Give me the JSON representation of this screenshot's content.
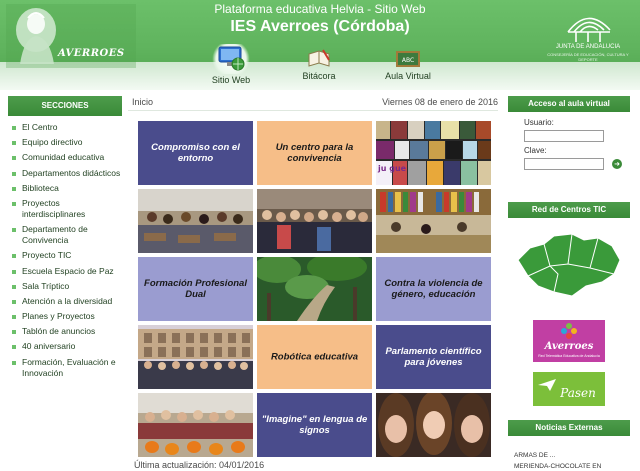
{
  "header": {
    "logo_text": "AVERROES",
    "platform": "Plataforma educativa Helvia - Sitio Web",
    "school": "IES Averroes (Córdoba)",
    "junta_name": "JUNTA DE ANDALUCIA",
    "junta_sub": "CONSEJERÍA DE EDUCACIÓN, CULTURA Y DEPORTE",
    "nav": [
      {
        "label": "Sitio Web",
        "icon": "monitor-globe-icon",
        "active": true
      },
      {
        "label": "Bitácora",
        "icon": "book-pen-icon",
        "active": false
      },
      {
        "label": "Aula Virtual",
        "icon": "abc-board-icon",
        "active": false
      }
    ]
  },
  "sidebar": {
    "title": "SECCIONES",
    "items": [
      "El Centro",
      "Equipo directivo",
      "Comunidad educativa",
      "Departamentos didácticos",
      "Biblioteca",
      "Proyectos interdisciplinares",
      "Departamento de Convivencia",
      "Proyecto TIC",
      "Escuela Espacio de Paz",
      "Sala Tríptico",
      "Atención a la diversidad",
      "Planes y Proyectos",
      "Tablón de anuncios",
      "40 aniversario",
      "Formación, Evaluación e Innovación"
    ]
  },
  "main": {
    "breadcrumb": "Inicio",
    "date": "Viernes 08 de enero de 2016",
    "tiles": [
      {
        "kind": "text",
        "style": "blue",
        "text": "Compromiso con el entorno"
      },
      {
        "kind": "text",
        "style": "orange",
        "text": "Un centro para la convivencia"
      },
      {
        "kind": "photo",
        "subject": "book-covers-collage",
        "caption": "ju gue"
      },
      {
        "kind": "photo",
        "subject": "students-classroom"
      },
      {
        "kind": "photo",
        "subject": "students-hall-group"
      },
      {
        "kind": "photo",
        "subject": "library-students"
      },
      {
        "kind": "text",
        "style": "lav",
        "text": "Formación Profesional Dual"
      },
      {
        "kind": "photo",
        "subject": "forest-trail"
      },
      {
        "kind": "text",
        "style": "lav",
        "text": "Contra la violencia de género, educación"
      },
      {
        "kind": "photo",
        "subject": "colosseum-trip"
      },
      {
        "kind": "text",
        "style": "orange",
        "text": "Robótica educativa"
      },
      {
        "kind": "text",
        "style": "blue",
        "text": "Parlamento científico para jóvenes"
      },
      {
        "kind": "photo",
        "subject": "pumpkins-class"
      },
      {
        "kind": "text",
        "style": "blue",
        "text": "\"Imagine\" en lengua de signos"
      },
      {
        "kind": "photo",
        "subject": "three-girls"
      }
    ],
    "updated": "Última actualización: 04/01/2016"
  },
  "right": {
    "login_title": "Acceso al aula virtual",
    "user_label": "Usuario:",
    "user_value": "",
    "pass_label": "Clave:",
    "pass_value": "",
    "tic_title": "Red de Centros TIC",
    "banner1_text": "Averroes",
    "banner1_sub": "Red Telemática Educativa de Andalucía",
    "banner2_text": "Pasen",
    "news_title": "Noticias Externas",
    "news": [
      "ARMAS DE ...",
      "MERIENDA-CHOCOLATE EN ADULTOS"
    ]
  },
  "colors": {
    "header_green": "#5fb35d",
    "section_green": "#3a8a38",
    "tile_blue": "#4a4c8c",
    "tile_orange": "#f6be88",
    "tile_lavender": "#9a9cd0"
  }
}
